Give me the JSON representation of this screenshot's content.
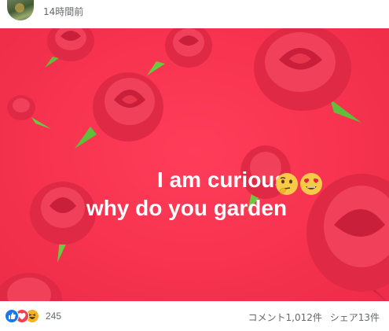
{
  "post": {
    "timestamp": "14時間前",
    "image_text_line1": "I am curious",
    "image_text_line2": "why do you garden",
    "image_bg_color": "#f7334f"
  },
  "reactions": {
    "icons": [
      "like-icon",
      "love-icon",
      "haha-icon"
    ],
    "count": "245"
  },
  "stats": {
    "comments": "コメント1,012件",
    "shares": "シェア13件"
  }
}
